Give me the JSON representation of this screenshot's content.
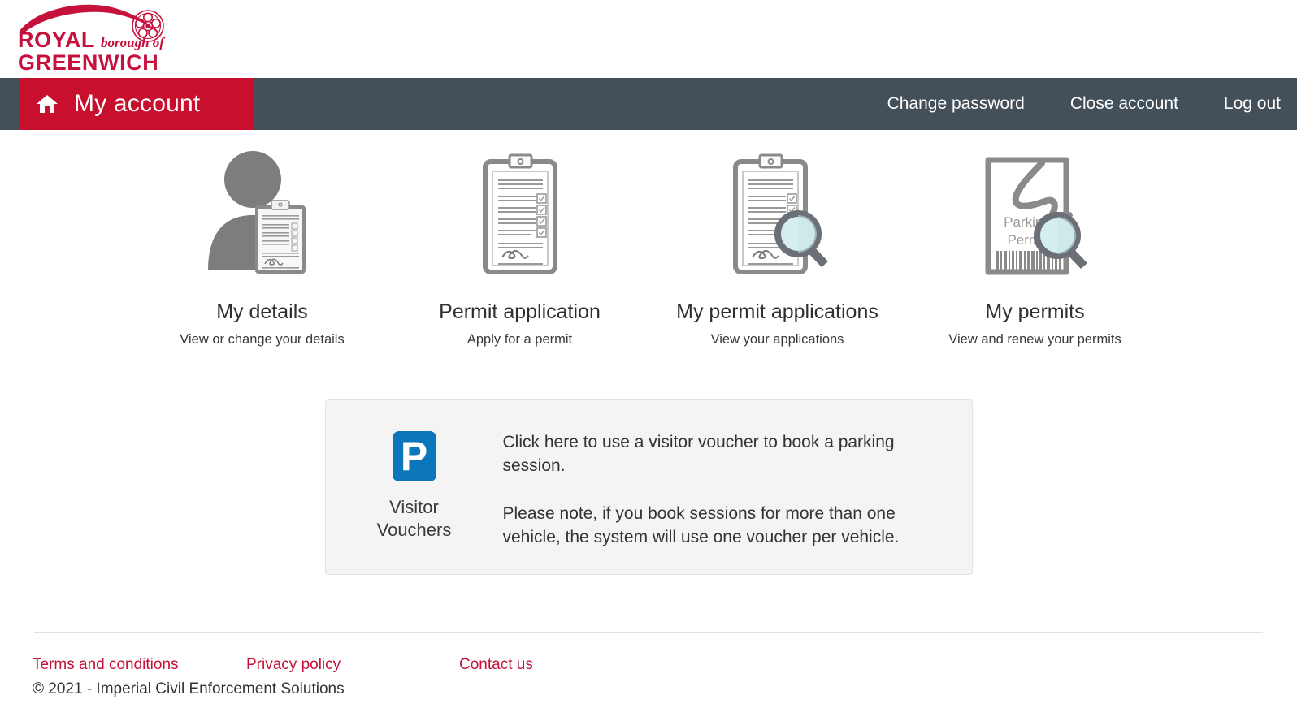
{
  "brand": {
    "logo_line1": "ROYAL",
    "logo_italic": "borough of",
    "logo_line2": "GREENWICH",
    "logo_color": "#c5123c",
    "rose_icon": "tudor-rose-icon"
  },
  "navbar": {
    "home_icon": "home-icon",
    "title": "My account",
    "brand_bg": "#c8102e",
    "bar_bg": "#434f59",
    "links": [
      {
        "label": "Change password"
      },
      {
        "label": "Close account"
      },
      {
        "label": "Log out"
      }
    ]
  },
  "tiles": [
    {
      "icon": "person-with-clipboard-icon",
      "title": "My details",
      "subtitle": "View or change your details"
    },
    {
      "icon": "clipboard-checklist-icon",
      "title": "Permit application",
      "subtitle": "Apply for a permit"
    },
    {
      "icon": "clipboard-checklist-magnifier-icon",
      "title": "My permit applications",
      "subtitle": "View your applications"
    },
    {
      "icon": "parking-permit-magnifier-icon",
      "title": "My permits",
      "subtitle": "View and renew your permits"
    }
  ],
  "permit_card": {
    "line1": "Parking",
    "line2": "Permit"
  },
  "voucher": {
    "badge_letter": "P",
    "badge_color": "#0c76ba",
    "label_line1": "Visitor",
    "label_line2": "Vouchers",
    "paragraph1": "Click here to use a visitor voucher to book a parking session.",
    "paragraph2": "Please note, if you book sessions for more than one vehicle, the system will use one voucher per vehicle.",
    "panel_bg": "#f4f4f4"
  },
  "footer": {
    "links": [
      {
        "label": "Terms and conditions"
      },
      {
        "label": "Privacy policy"
      },
      {
        "label": "Contact us"
      }
    ],
    "copyright": "© 2021 - Imperial Civil Enforcement Solutions",
    "link_color": "#c5123c"
  }
}
